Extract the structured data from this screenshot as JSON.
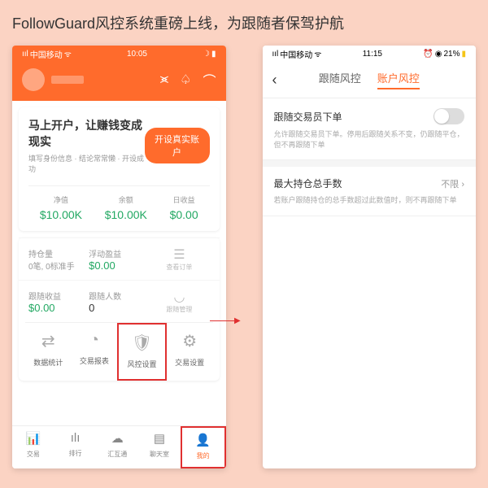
{
  "title": "FollowGuard风控系统重磅上线，为跟随者保驾护航",
  "p1": {
    "status": {
      "carrier": "中国移动",
      "time": "10:05"
    },
    "card": {
      "title": "马上开户，让赚钱变成现实",
      "subtitle": "填写身份信息 · 结论常常懒 · 开设成功",
      "btn": "开设真实账户"
    },
    "vals": [
      {
        "lbl": "净值",
        "amt": "$10.00K"
      },
      {
        "lbl": "余额",
        "amt": "$10.00K"
      },
      {
        "lbl": "日收益",
        "amt": "$0.00"
      }
    ],
    "r2": {
      "l1": "持仓量",
      "l2": "0笔, 0标准手",
      "r1": "浮动盈益",
      "r2": "$0.00",
      "ic": "查看订单"
    },
    "r3": {
      "l1": "跟随收益",
      "l2": "$0.00",
      "r1": "跟随人数",
      "r2": "0",
      "ic": "跟随管理"
    },
    "tabs": [
      {
        "ic": "⇄",
        "lb": "数据统计"
      },
      {
        "ic": "◔",
        "lb": "交易报表"
      },
      {
        "ic": "🛡",
        "lb": "风控设置"
      },
      {
        "ic": "⚙",
        "lb": "交易设置"
      }
    ],
    "btabs": [
      {
        "ic": "📊",
        "lb": "交易"
      },
      {
        "ic": "ılı",
        "lb": "排行"
      },
      {
        "ic": "☁",
        "lb": "汇互通"
      },
      {
        "ic": "▤",
        "lb": "聊天室"
      },
      {
        "ic": "👤",
        "lb": "我的"
      }
    ]
  },
  "p2": {
    "status": {
      "carrier": "中国移动",
      "time": "11:15",
      "battery": "21%"
    },
    "htabs": [
      "跟随风控",
      "账户风控"
    ],
    "s1": {
      "title": "跟随交易员下单",
      "desc": "允许跟随交易员下单。停用后跟随关系不变，仍跟随平仓，但不再跟随下单"
    },
    "s2": {
      "title": "最大持仓总手数",
      "val": "不限",
      "desc": "若账户跟随持仓的总手数超过此数值时，则不再跟随下单"
    }
  }
}
